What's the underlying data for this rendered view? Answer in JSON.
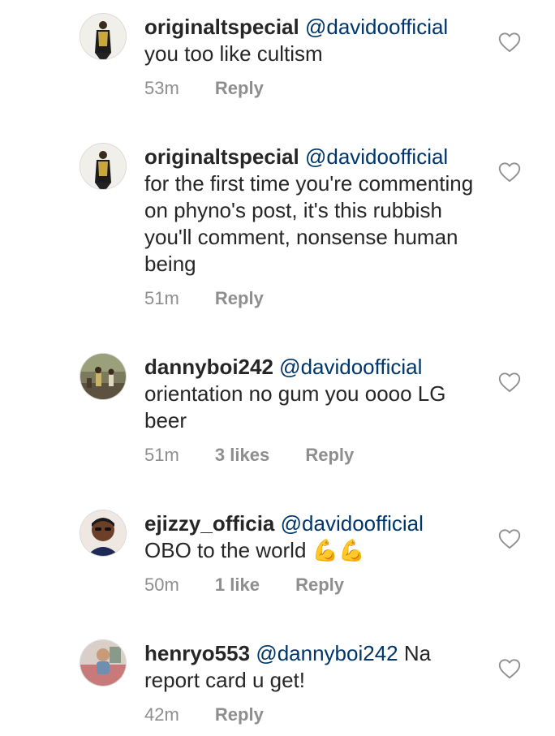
{
  "comments": [
    {
      "username": "originaltspecial",
      "mention": "@davidoofficial",
      "text": "you too like cultism",
      "time": "53m",
      "likes": "",
      "reply_label": "Reply"
    },
    {
      "username": "originaltspecial",
      "mention": "@davidoofficial",
      "text": "for the first time you're commenting on phyno's post, it's this rubbish you'll comment, nonsense human being",
      "time": "51m",
      "likes": "",
      "reply_label": "Reply"
    },
    {
      "username": "dannyboi242",
      "mention": "@davidoofficial",
      "text": "orientation no gum you oooo LG beer",
      "time": "51m",
      "likes": "3 likes",
      "reply_label": "Reply"
    },
    {
      "username": "ejizzy_officia",
      "mention": "@davidoofficial",
      "text": "OBO to the world",
      "emoji": "💪💪",
      "time": "50m",
      "likes": "1 like",
      "reply_label": "Reply"
    },
    {
      "username": "henryo553",
      "mention": "@dannyboi242",
      "text": "Na report card u get!",
      "time": "42m",
      "likes": "",
      "reply_label": "Reply"
    }
  ],
  "icons": {
    "like": "heart-outline-icon"
  },
  "colors": {
    "text": "#262626",
    "mention": "#003569",
    "meta": "#8e8e8e"
  }
}
